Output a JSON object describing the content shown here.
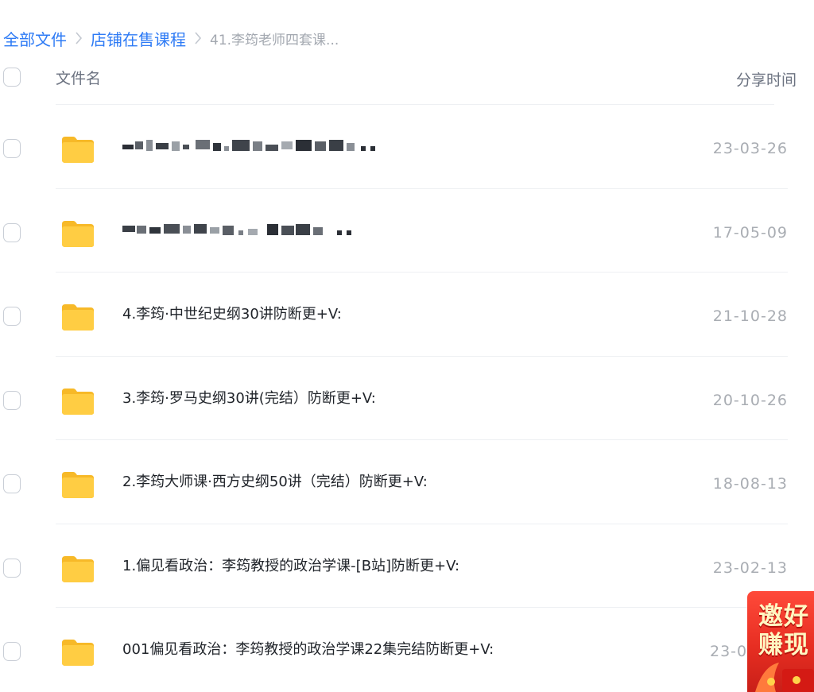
{
  "breadcrumb": {
    "items": [
      "全部文件",
      "店铺在售课程"
    ],
    "current": "41.李筠老师四套课..."
  },
  "header": {
    "name_label": "文件名",
    "time_label": "分享时间"
  },
  "files": [
    {
      "name": "",
      "date": "23-03-26",
      "blurred": true
    },
    {
      "name": "",
      "date": "17-05-09",
      "blurred": true
    },
    {
      "name": "4.李筠·中世纪史纲30讲防断更+V:",
      "date": "21-10-28"
    },
    {
      "name": "3.李筠·罗马史纲30讲(完结）防断更+V:",
      "date": "20-10-26"
    },
    {
      "name": "2.李筠大师课·西方史纲50讲（完结）防断更+V:",
      "date": "18-08-13"
    },
    {
      "name": "1.偏见看政治：李筠教授的政治学课-[B站]防断更+V:",
      "date": "23-02-13"
    },
    {
      "name": "001偏见看政治：李筠教授的政治学课22集完结防断更+V:",
      "date": "23-0"
    }
  ],
  "promo": {
    "line1": "邀好",
    "line2": "赚现"
  },
  "colors": {
    "link": "#2e7bf5",
    "folder": "#ffc93b",
    "promo": "#e72e22"
  },
  "icons": {
    "folder": "folder-icon",
    "separator": "chevron-right-icon"
  }
}
